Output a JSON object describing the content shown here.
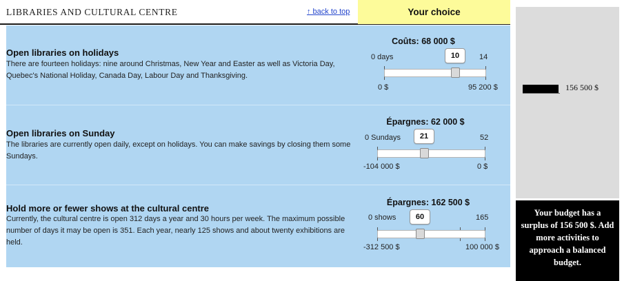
{
  "header": {
    "section_title": "LIBRARIES AND CULTURAL CENTRE",
    "back_to_top": "↑ back to top",
    "choice_title": "Your choice"
  },
  "items": [
    {
      "title": "Open libraries on holidays",
      "description": "There are fourteen holidays: nine around Christmas, New Year and Easter as well as Victoria Day, Quebec's National Holiday, Canada Day, Labour Day and Thanksgiving.",
      "amount_label": "Coûts: 68 000 $",
      "min_label": "0 days",
      "max_label": "14",
      "value": 10,
      "min": 0,
      "max": 14,
      "low_amount": "0 $",
      "high_amount": "95 200 $"
    },
    {
      "title": "Open libraries on Sunday",
      "description": "The libraries are currently open daily, except on holidays. You can make savings by closing them some Sundays.",
      "amount_label": "Épargnes: 62 000 $",
      "min_label": "0 Sundays",
      "max_label": "52",
      "value": 21,
      "min": 0,
      "max": 52,
      "low_amount": "-104 000 $",
      "high_amount": "0 $"
    },
    {
      "title": "Hold more or fewer shows at the cultural centre",
      "description": "Currently, the cultural centre is open 312 days a year and 30 hours per week. The maximum possible number of days it may be open is 351. Each year, nearly 125 shows and about twenty exhibitions are held.",
      "amount_label": "Épargnes: 162 500 $",
      "min_label": "0 shows",
      "max_label": "165",
      "value": 60,
      "min": 0,
      "max": 165,
      "low_amount": "-312 500 $",
      "high_amount": "100 000 $"
    }
  ],
  "budget": {
    "amount": "156 500 $",
    "message": "Your budget has a surplus of 156 500 $. Add more activities to approach a balanced budget."
  },
  "colors": {
    "panel_blue": "#b0d6f2",
    "choice_yellow": "#fdfb9a",
    "sidebar_gray": "#dcdcdc",
    "message_black": "#000000"
  }
}
